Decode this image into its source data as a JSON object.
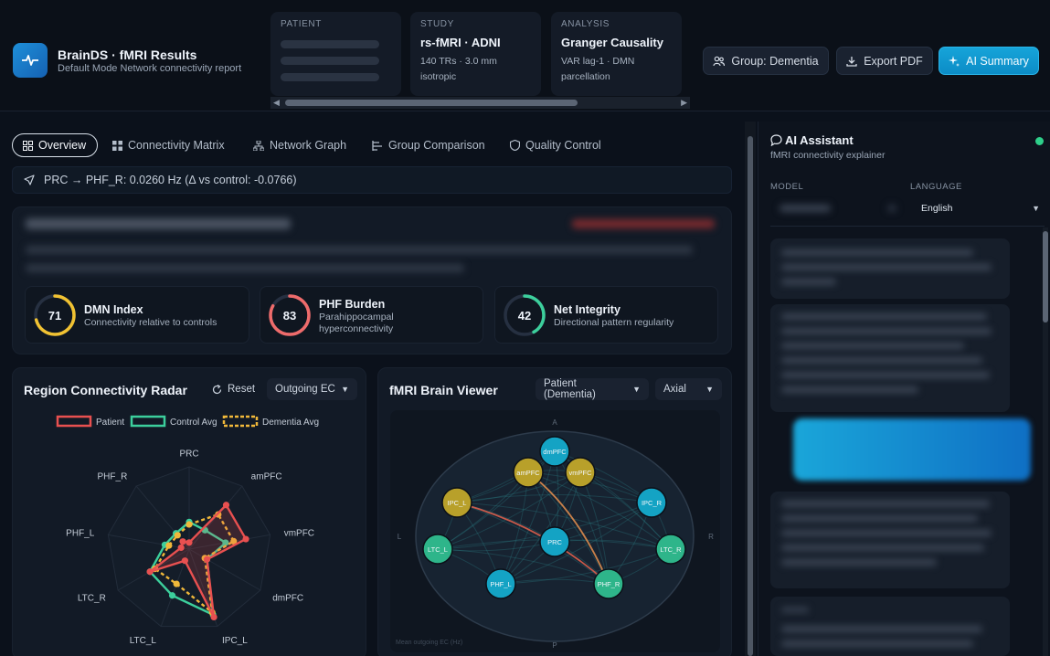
{
  "header": {
    "app_title": "BrainDS · fMRI Results",
    "app_subtitle": "Default Mode Network connectivity report",
    "logo_icon": "pulse-icon",
    "cards": {
      "patient": {
        "caption": "PATIENT"
      },
      "study": {
        "caption": "STUDY",
        "value": "rs-fMRI · ADNI",
        "line1": "140 TRs · 3.0 mm",
        "line2": "isotropic"
      },
      "analysis": {
        "caption": "ANALYSIS",
        "value": "Granger Causality",
        "line1": "VAR lag-1 · DMN",
        "line2": "parcellation"
      }
    },
    "buttons": {
      "group": "Group: Dementia",
      "export": "Export PDF",
      "ai_summary": "AI Summary"
    }
  },
  "tabs": [
    {
      "label": "Overview",
      "icon": "grid-icon"
    },
    {
      "label": "Connectivity Matrix",
      "icon": "matrix-icon"
    },
    {
      "label": "Network Graph",
      "icon": "network-icon"
    },
    {
      "label": "Group Comparison",
      "icon": "compare-icon"
    },
    {
      "label": "Quality Control",
      "icon": "shield-icon"
    }
  ],
  "path_readout": "PRC → PHF_R: 0.0260 Hz (Δ vs control: -0.0766)",
  "metrics": [
    {
      "value": "71",
      "score": 71,
      "title": "DMN Index",
      "desc": "Connectivity relative to controls",
      "color": "#f1c232"
    },
    {
      "value": "83",
      "score": 83,
      "title": "PHF Burden",
      "desc": "Parahippocampal hyperconnectivity",
      "color": "#ee6b6b"
    },
    {
      "value": "42",
      "score": 42,
      "title": "Net Integrity",
      "desc": "Directional pattern regularity",
      "color": "#3ccf9c"
    }
  ],
  "radar": {
    "title": "Region Connectivity Radar",
    "reset_label": "Reset",
    "mode": "Outgoing EC",
    "legend": [
      {
        "name": "Patient",
        "color": "#e85050"
      },
      {
        "name": "Control Avg",
        "color": "#3ccf9c"
      },
      {
        "name": "Dementia Avg",
        "color": "#f0b83a"
      }
    ],
    "axes": [
      "PRC",
      "amPFC",
      "vmPFC",
      "dmPFC",
      "IPC_L",
      "LTC_L",
      "LTC_R",
      "PHF_L",
      "PHF_R"
    ],
    "series": {
      "patient": [
        0.08,
        0.7,
        0.7,
        0.25,
        0.88,
        0.15,
        0.55,
        0.1,
        0.12
      ],
      "control": [
        0.33,
        0.3,
        0.45,
        0.25,
        0.85,
        0.6,
        0.55,
        0.3,
        0.25
      ],
      "dementia": [
        0.3,
        0.55,
        0.55,
        0.22,
        0.82,
        0.45,
        0.48,
        0.25,
        0.22
      ]
    }
  },
  "viewer": {
    "title": "fMRI Brain Viewer",
    "subject": "Patient (Dementia)",
    "plane": "Axial",
    "orient": {
      "top": "A",
      "bottom": "P",
      "left": "L",
      "right": "R"
    },
    "caption": "Mean outgoing EC (Hz)",
    "nodes": [
      {
        "id": "dmPFC",
        "color": "#14a3c4"
      },
      {
        "id": "amPFC",
        "color": "#b8a02a"
      },
      {
        "id": "vmPFC",
        "color": "#b8a02a"
      },
      {
        "id": "IPC_L",
        "color": "#b8a02a"
      },
      {
        "id": "IPC_R",
        "color": "#14a3c4"
      },
      {
        "id": "PRC",
        "color": "#14a3c4"
      },
      {
        "id": "LTC_L",
        "color": "#2eb58a"
      },
      {
        "id": "LTC_R",
        "color": "#2eb58a"
      },
      {
        "id": "PHF_L",
        "color": "#14a3c4"
      },
      {
        "id": "PHF_R",
        "color": "#2eb58a"
      }
    ]
  },
  "assistant": {
    "title": "AI Assistant",
    "subtitle": "fMRI connectivity explainer",
    "model_label": "MODEL",
    "language_label": "LANGUAGE",
    "language": "English",
    "status_color": "#2ecf8a"
  }
}
